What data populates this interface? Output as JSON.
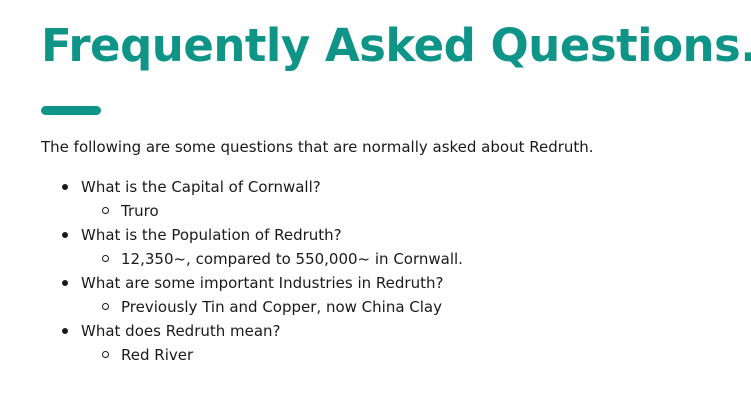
{
  "header": {
    "title": "Frequently Asked Questions.",
    "accent_color": "#0f9488"
  },
  "intro": "The following are some questions that are normally asked about Redruth.",
  "faq": [
    {
      "question": "What is the Capital of Cornwall?",
      "answer": "Truro"
    },
    {
      "question": "What is the Population of Redruth?",
      "answer": "12,350~, compared to 550,000~ in Cornwall."
    },
    {
      "question": "What are some important Industries in Redruth?",
      "answer": "Previously Tin and Copper, now China Clay"
    },
    {
      "question": "What does Redruth mean?",
      "answer": "Red River"
    }
  ]
}
